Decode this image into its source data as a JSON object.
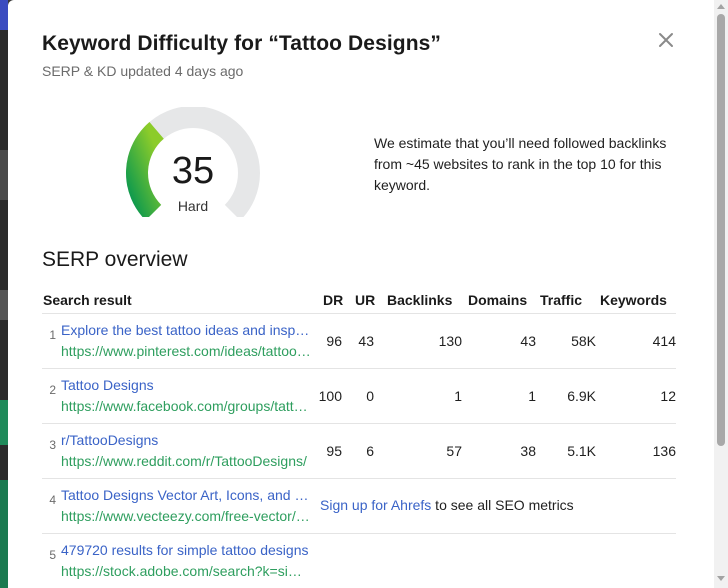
{
  "modal": {
    "title": "Keyword Difficulty for “Tattoo Designs”",
    "subtitle": "SERP & KD updated 4 days ago"
  },
  "difficulty": {
    "value": "35",
    "label": "Hard",
    "gauge_fraction": 0.35,
    "gauge_color": "#19a14a",
    "track_color": "#e6e7e8"
  },
  "estimate_text": "We estimate that you’ll need followed backlinks from ~45 websites to rank in the top 10 for this keyword.",
  "serp": {
    "title": "SERP overview",
    "columns": {
      "result": "Search result",
      "dr": "DR",
      "ur": "UR",
      "backlinks": "Backlinks",
      "domains": "Domains",
      "traffic": "Traffic",
      "keywords": "Keywords"
    },
    "rows": [
      {
        "rank": "1",
        "title": "Explore the best tattoo ideas and inspiration",
        "url": "https://www.pinterest.com/ideas/tattoo-designs/",
        "dr": "96",
        "ur": "43",
        "backlinks": "130",
        "domains": "43",
        "traffic": "58K",
        "keywords": "414"
      },
      {
        "rank": "2",
        "title": "Tattoo Designs",
        "url": "https://www.facebook.com/groups/tattoodesigns/",
        "dr": "100",
        "ur": "0",
        "backlinks": "1",
        "domains": "1",
        "traffic": "6.9K",
        "keywords": "12"
      },
      {
        "rank": "3",
        "title": "r/TattooDesigns",
        "url": "https://www.reddit.com/r/TattooDesigns/",
        "dr": "95",
        "ur": "6",
        "backlinks": "57",
        "domains": "38",
        "traffic": "5.1K",
        "keywords": "136"
      },
      {
        "rank": "4",
        "title": "Tattoo Designs Vector Art, Icons, and Graphics",
        "url": "https://www.vecteezy.com/free-vector/tattoo-designs",
        "signup_link": "Sign up for Ahrefs",
        "signup_rest": " to see all SEO metrics"
      },
      {
        "rank": "5",
        "title": "479720 results for simple tattoo designs",
        "url": "https://stock.adobe.com/search?k=simple+tattoo+designs"
      }
    ]
  },
  "icons": {
    "close": "close-icon"
  }
}
